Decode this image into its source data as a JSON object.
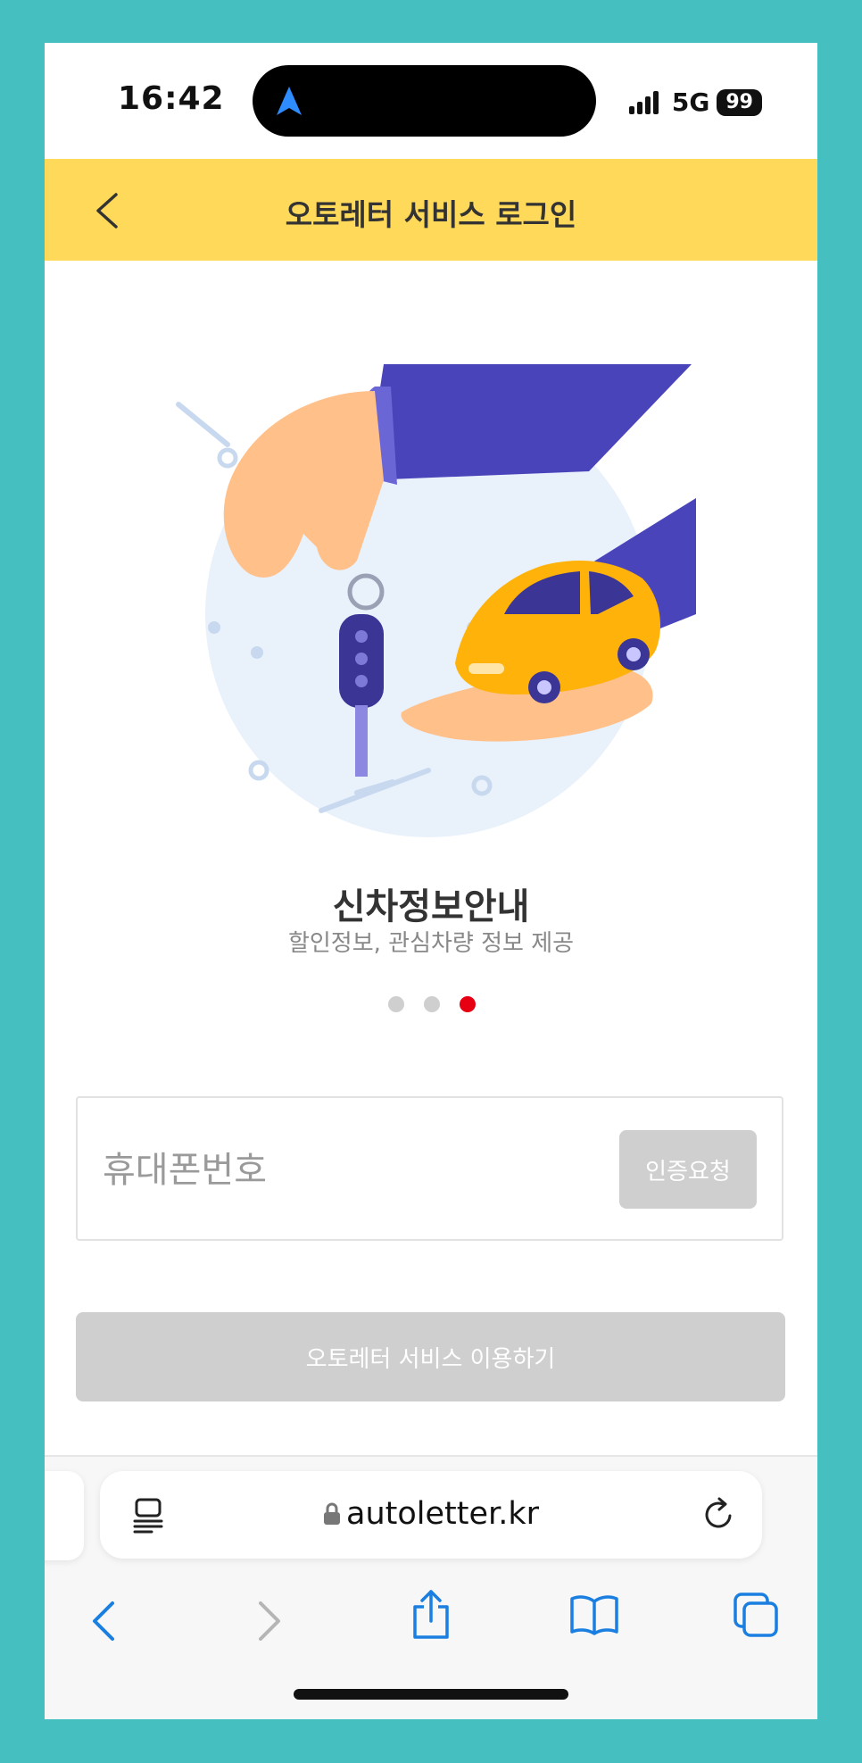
{
  "status_bar": {
    "time": "16:42",
    "network": "5G",
    "battery": "99"
  },
  "header": {
    "title": "오토레터 서비스 로그인"
  },
  "carousel": {
    "title": "신차정보안내",
    "subtitle": "할인정보, 관심차량 정보 제공",
    "dots": 3,
    "active_index": 2
  },
  "form": {
    "phone_placeholder": "휴대폰번호",
    "verify_label": "인증요청",
    "submit_label": "오토레터 서비스 이용하기"
  },
  "browser": {
    "url": "autoletter.kr"
  },
  "colors": {
    "header_bg": "#ffd95a",
    "active_dot": "#e60012",
    "disabled_button": "#cfcfcf",
    "ios_blue": "#1a7fe0"
  }
}
